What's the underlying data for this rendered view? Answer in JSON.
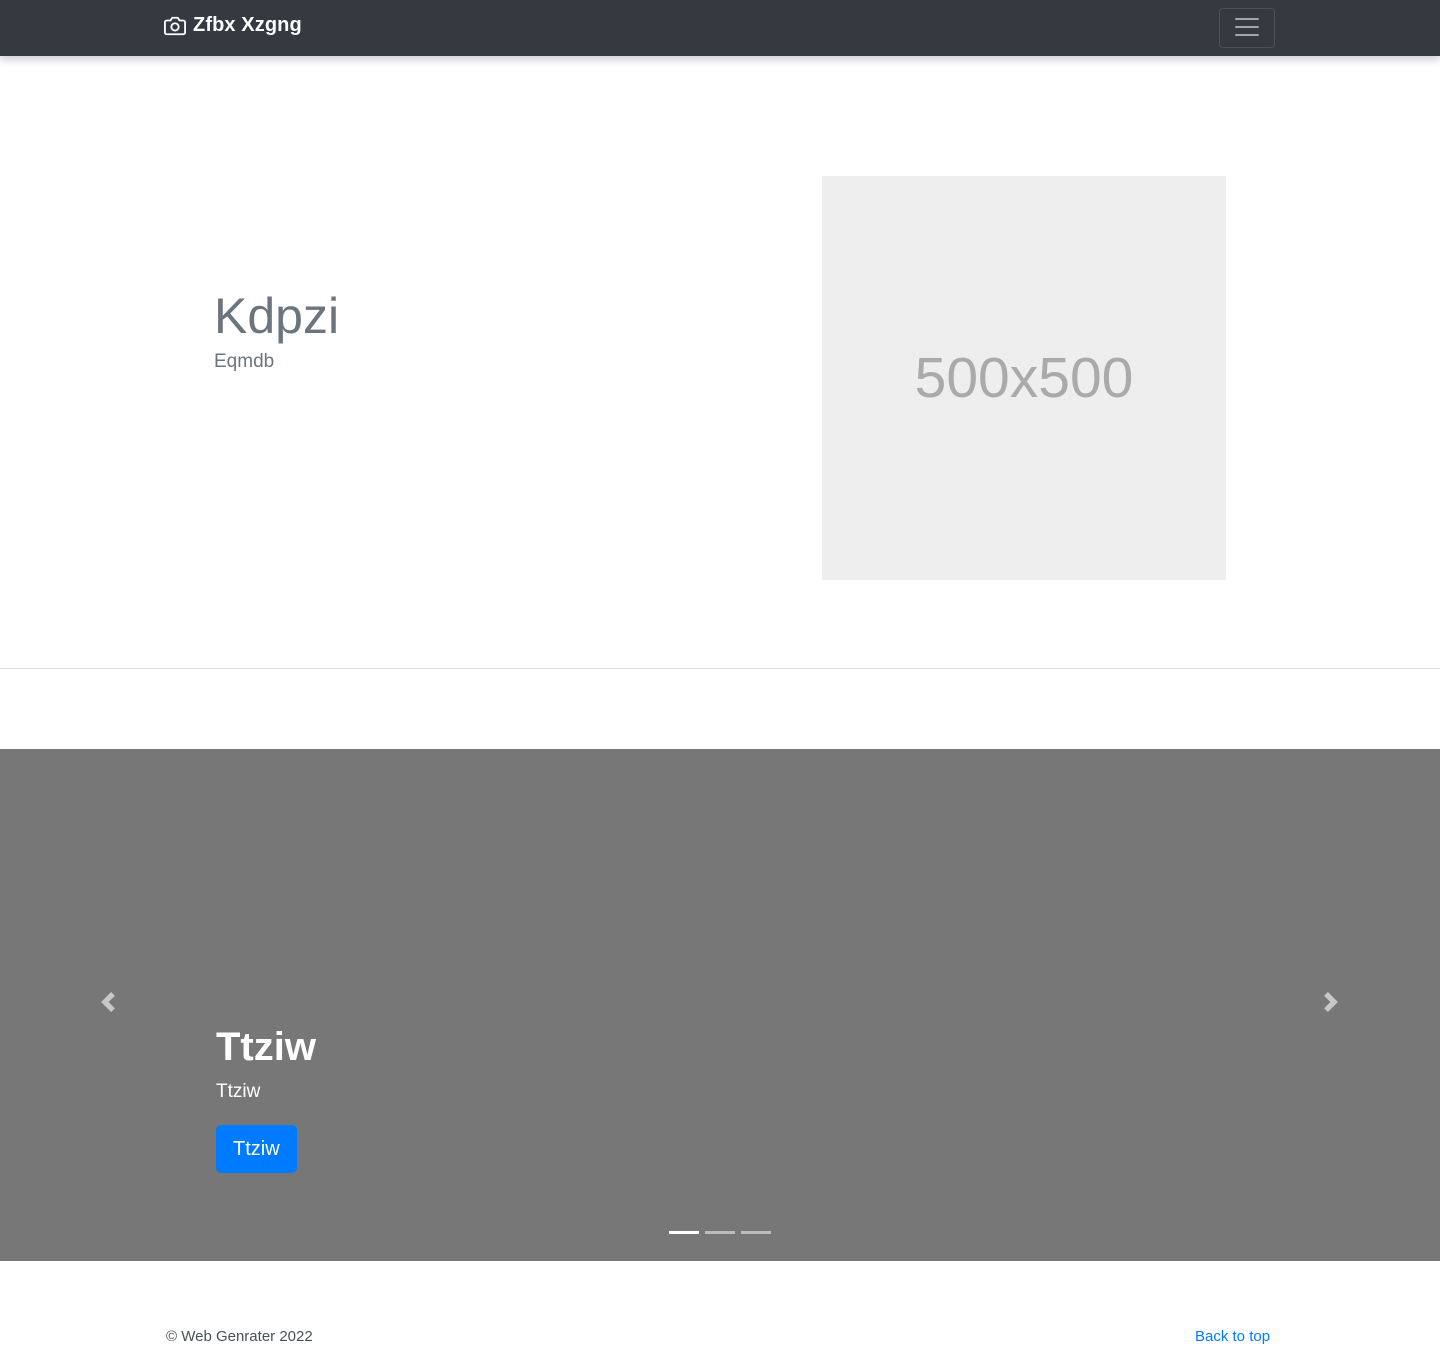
{
  "navbar": {
    "brand_icon": "camera-icon",
    "brand_name": "Zfbx Xzgng",
    "toggler_icon": "menu-icon"
  },
  "hero": {
    "title": "Kdpzi",
    "subtitle": "Eqmdb",
    "image_placeholder": "500x500"
  },
  "carousel": {
    "prev_icon": "chevron-left-icon",
    "next_icon": "chevron-right-icon",
    "slide": {
      "heading": "Ttziw",
      "text": "Ttziw",
      "button_label": "Ttziw"
    },
    "indicators": [
      {
        "active": true
      },
      {
        "active": false
      },
      {
        "active": false
      }
    ]
  },
  "footer": {
    "copyright": "© Web Genrater 2022",
    "back_to_top": "Back to top"
  },
  "colors": {
    "navbar_bg": "#343a40",
    "carousel_bg": "#777777",
    "primary": "#007bff",
    "placeholder_bg": "#eeeeee",
    "placeholder_text": "#aaaaaa",
    "muted_text": "#6c757d"
  }
}
